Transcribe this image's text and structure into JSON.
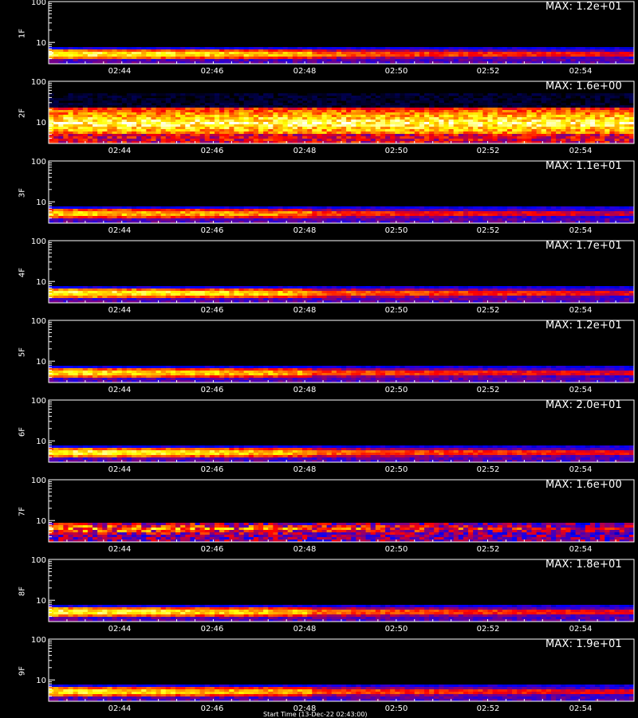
{
  "chart_data": [
    {
      "type": "heatmap",
      "ylabel": "1F",
      "max_label": "MAX: 1.2e+01",
      "yticks": [
        "100",
        "10"
      ],
      "xticks": [
        "02:44",
        "02:46",
        "02:48",
        "02:50",
        "02:52",
        "02:54"
      ],
      "band": "low",
      "intensity": 1.0
    },
    {
      "type": "heatmap",
      "ylabel": "2F",
      "max_label": "MAX: 1.6e+00",
      "yticks": [
        "100",
        "10"
      ],
      "xticks": [
        "02:44",
        "02:46",
        "02:48",
        "02:50",
        "02:52",
        "02:54"
      ],
      "band": "wide",
      "intensity": 1.0
    },
    {
      "type": "heatmap",
      "ylabel": "3F",
      "max_label": "MAX: 1.1e+01",
      "yticks": [
        "100",
        "10"
      ],
      "xticks": [
        "02:44",
        "02:46",
        "02:48",
        "02:50",
        "02:52",
        "02:54"
      ],
      "band": "low",
      "intensity": 0.9
    },
    {
      "type": "heatmap",
      "ylabel": "4F",
      "max_label": "MAX: 1.7e+01",
      "yticks": [
        "100",
        "10"
      ],
      "xticks": [
        "02:44",
        "02:46",
        "02:48",
        "02:50",
        "02:52",
        "02:54"
      ],
      "band": "low",
      "intensity": 1.0
    },
    {
      "type": "heatmap",
      "ylabel": "5F",
      "max_label": "MAX: 1.2e+01",
      "yticks": [
        "100",
        "10"
      ],
      "xticks": [
        "02:44",
        "02:46",
        "02:48",
        "02:50",
        "02:52",
        "02:54"
      ],
      "band": "low",
      "intensity": 0.95
    },
    {
      "type": "heatmap",
      "ylabel": "6F",
      "max_label": "MAX: 2.0e+01",
      "yticks": [
        "100",
        "10"
      ],
      "xticks": [
        "02:44",
        "02:46",
        "02:48",
        "02:50",
        "02:52",
        "02:54"
      ],
      "band": "low",
      "intensity": 1.0
    },
    {
      "type": "heatmap",
      "ylabel": "7F",
      "max_label": "MAX: 1.6e+00",
      "yticks": [
        "100",
        "10"
      ],
      "xticks": [
        "02:44",
        "02:46",
        "02:48",
        "02:50",
        "02:52",
        "02:54"
      ],
      "band": "noisy",
      "intensity": 0.8
    },
    {
      "type": "heatmap",
      "ylabel": "8F",
      "max_label": "MAX: 1.8e+01",
      "yticks": [
        "100",
        "10"
      ],
      "xticks": [
        "02:44",
        "02:46",
        "02:48",
        "02:50",
        "02:52",
        "02:54"
      ],
      "band": "low",
      "intensity": 1.0
    },
    {
      "type": "heatmap",
      "ylabel": "9F",
      "max_label": "MAX: 1.9e+01",
      "yticks": [
        "100",
        "10"
      ],
      "xticks": [
        "02:44",
        "02:46",
        "02:48",
        "02:50",
        "02:52",
        "02:54"
      ],
      "band": "low",
      "intensity": 0.95
    }
  ],
  "footer": {
    "text": "Start Time (13-Dec-22 02:43:00)"
  },
  "colors": {
    "background": "#000000",
    "axis": "#ffffff",
    "low": "#0000ff",
    "mid": "#ff0000",
    "high": "#ffff00",
    "peak": "#ffffff"
  }
}
